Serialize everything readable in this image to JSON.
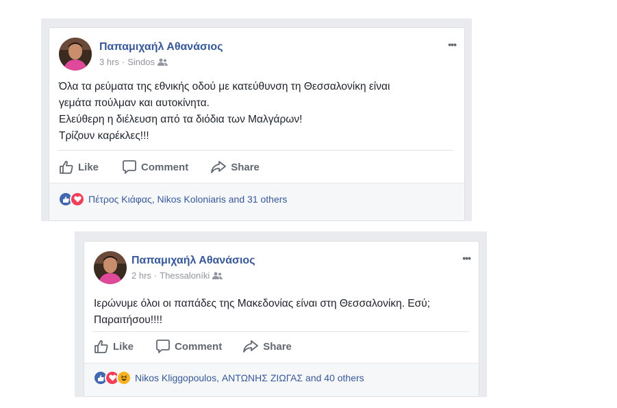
{
  "posts": [
    {
      "author": "Παπαμιχαήλ Αθανάσιος",
      "time": "3 hrs",
      "location": "Sindos",
      "more": "•••",
      "lines": [
        "Όλα τα ρεύματα της εθνικής οδού με κατεύθυνση τη Θεσσαλονίκη είναι",
        "γεμάτα πούλμαν και αυτοκίνητα.",
        "Ελεύθερη η διέλευση από τα διόδια των Μαλγάρων!",
        "Τρίζουν καρέκλες!!!"
      ],
      "actions": {
        "like": "Like",
        "comment": "Comment",
        "share": "Share"
      },
      "reactions": [
        "like",
        "love"
      ],
      "reaction_text": "Πέτρος Κιάφας, Nikos Koloniaris and 31 others"
    },
    {
      "author": "Παπαμιχαήλ Αθανάσιος",
      "time": "2 hrs",
      "location": "Thessaloníki",
      "more": "•••",
      "lines": [
        "Ιερώνυμε όλοι οι παπάδες της Μακεδονίας είναι στη Θεσσαλονίκη. Εσύ;",
        "Παραιτήσου!!!!"
      ],
      "actions": {
        "like": "Like",
        "comment": "Comment",
        "share": "Share"
      },
      "reactions": [
        "like",
        "love",
        "haha"
      ],
      "reaction_text": "Nikos Kliggopoulos, ΑΝΤΩΝΗΣ ΖΙΩΓΑΣ and 40 others"
    }
  ],
  "colors": {
    "link": "#365899",
    "meta": "#90949c",
    "like": "#4267b2",
    "love": "#f33e58",
    "haha": "#f7b125"
  }
}
